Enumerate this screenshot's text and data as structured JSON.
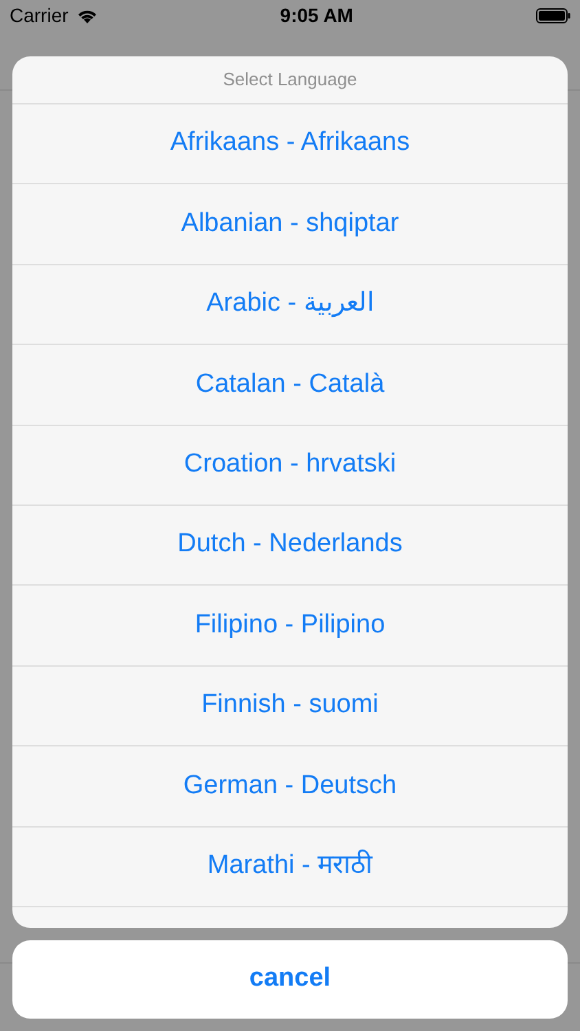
{
  "status_bar": {
    "carrier": "Carrier",
    "time": "9:05 AM"
  },
  "action_sheet": {
    "title": "Select Language",
    "options": [
      "Afrikaans - Afrikaans",
      "Albanian - shqiptar",
      "Arabic - العربية",
      "Catalan - Català",
      "Croation - hrvatski",
      "Dutch - Nederlands",
      "Filipino - Pilipino",
      "Finnish - suomi",
      "German - Deutsch",
      "Marathi - मराठी"
    ],
    "cancel": "cancel"
  }
}
